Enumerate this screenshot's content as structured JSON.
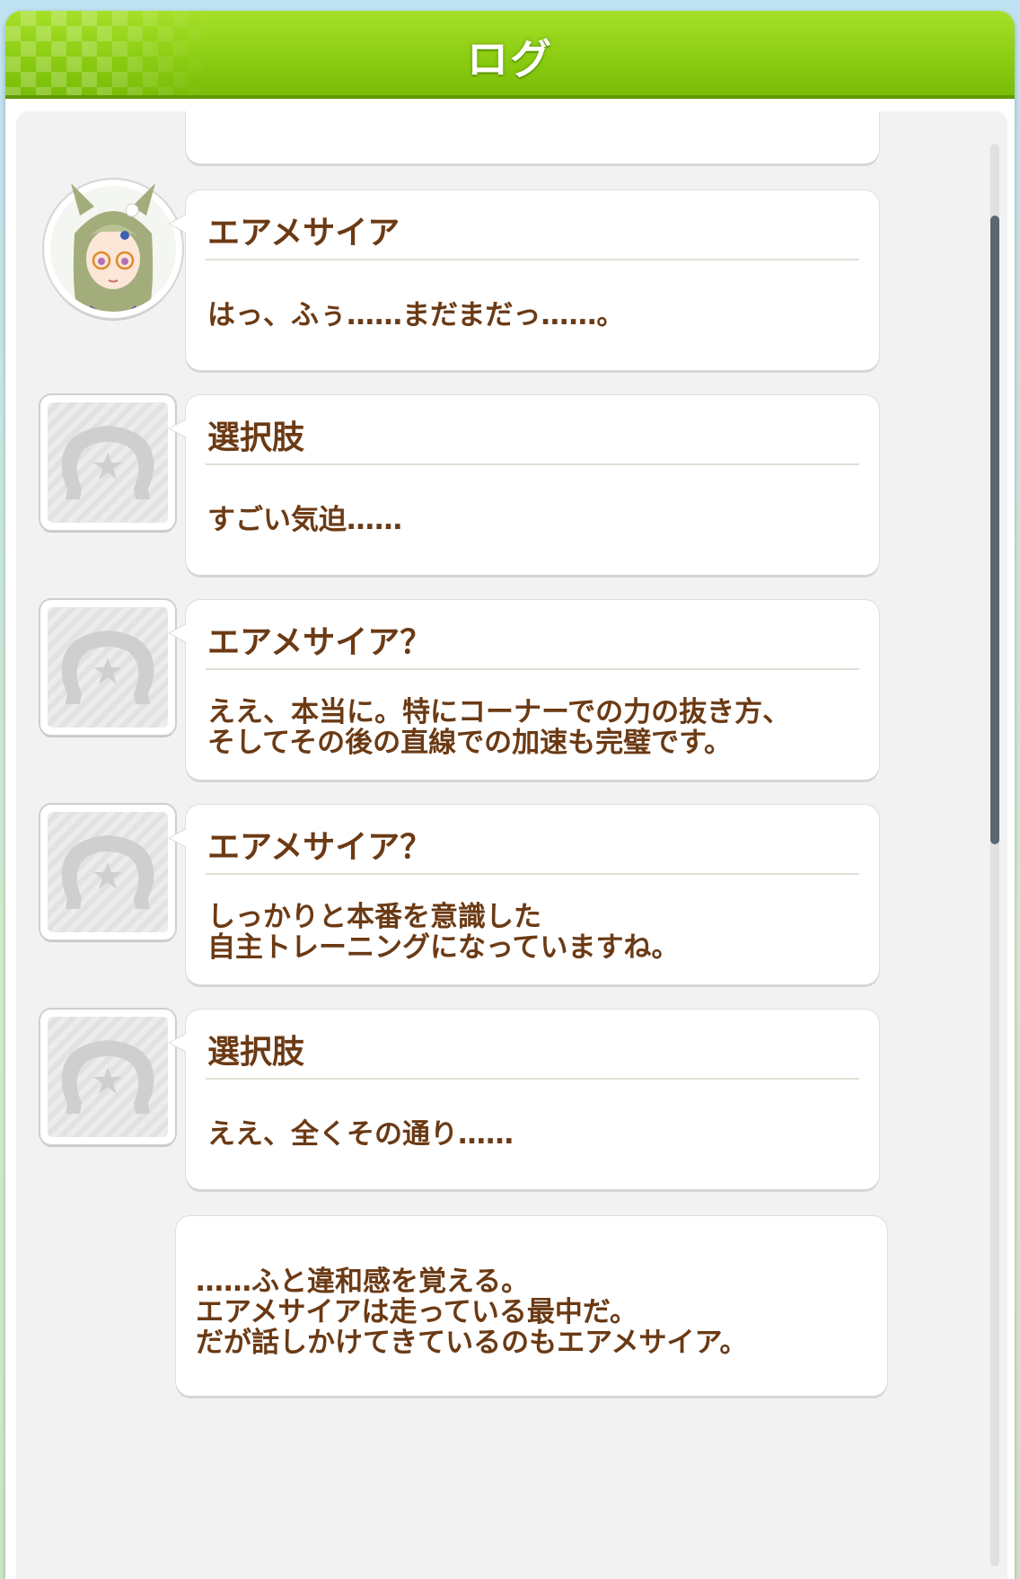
{
  "header": {
    "title": "ログ"
  },
  "entries": [
    {
      "type": "partial",
      "speaker": "",
      "text": ""
    },
    {
      "type": "character",
      "speaker": "エアメサイア",
      "text": "はっ、ふぅ……まだまだっ……。",
      "avatar": "character-portrait"
    },
    {
      "type": "choice",
      "speaker": "選択肢",
      "text": "すごい気迫……",
      "avatar": "horseshoe-placeholder-icon"
    },
    {
      "type": "unknown",
      "speaker": "エアメサイア？",
      "text": "ええ、本当に。特にコーナーでの力の抜き方、\nそしてその後の直線での加速も完璧です。",
      "avatar": "horseshoe-placeholder-icon"
    },
    {
      "type": "unknown",
      "speaker": "エアメサイア？",
      "text": "しっかりと本番を意識した\n自主トレーニングになっていますね。",
      "avatar": "horseshoe-placeholder-icon"
    },
    {
      "type": "choice",
      "speaker": "選択肢",
      "text": "ええ、全くその通り……",
      "avatar": "horseshoe-placeholder-icon"
    },
    {
      "type": "narration",
      "speaker": "",
      "text": "……ふと違和感を覚える。\nエアメサイアは走っている最中だ。\nだが話しかけてきているのもエアメサイア。"
    }
  ],
  "colors": {
    "header_green": "#8ccd12",
    "text_brown": "#6b3a14",
    "panel_bg": "#f2f2f2",
    "scrollbar": "#5b6770"
  }
}
